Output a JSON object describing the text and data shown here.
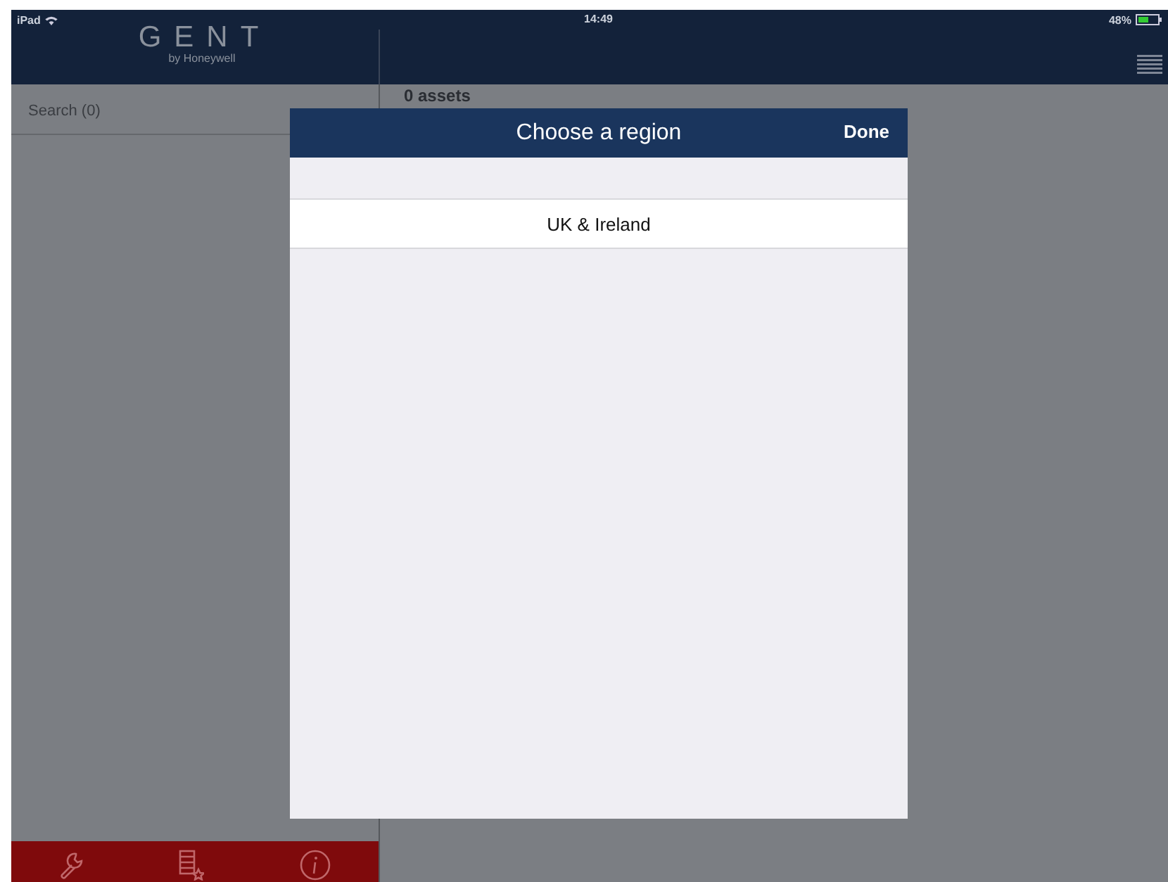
{
  "status_bar": {
    "device": "iPad",
    "time": "14:49",
    "battery": "48%"
  },
  "logo": {
    "name": "GENT",
    "tagline": "by Honeywell"
  },
  "sidebar": {
    "search": "Search (0)",
    "tabs": [
      {
        "kind": "wrench"
      },
      {
        "kind": "list-star"
      },
      {
        "kind": "info"
      }
    ]
  },
  "main": {
    "count": "0 assets"
  },
  "dialog": {
    "title": "Choose a region",
    "done": "Done",
    "items": [
      {
        "label": "UK & Ireland"
      }
    ]
  }
}
